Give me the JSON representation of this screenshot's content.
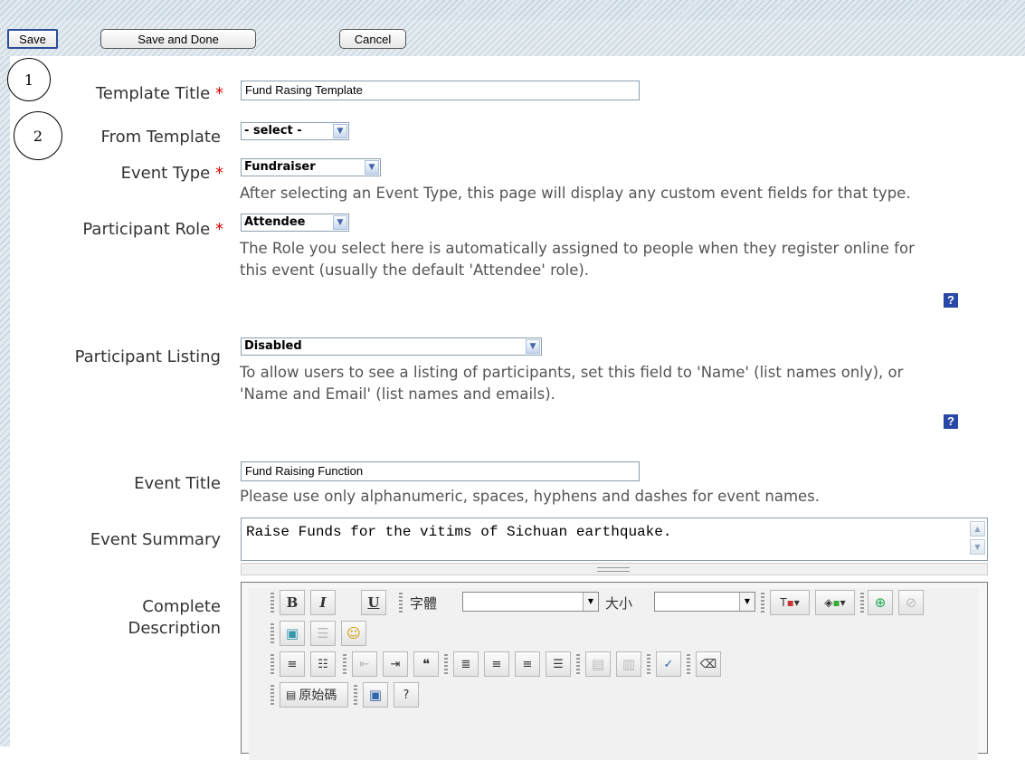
{
  "toolbar": {
    "save_label": "Save",
    "save_done_label": "Save and Done",
    "cancel_label": "Cancel"
  },
  "markers": [
    "1",
    "2"
  ],
  "form": {
    "template_title": {
      "label": "Template Title",
      "required": "*",
      "value": "Fund Rasing Template"
    },
    "from_template": {
      "label": "From Template",
      "value": "- select -"
    },
    "event_type": {
      "label": "Event Type",
      "required": "*",
      "value": "Fundraiser",
      "hint": "After selecting an Event Type, this page will display any custom event fields for that type."
    },
    "participant_role": {
      "label": "Participant Role",
      "required": "*",
      "value": "Attendee",
      "hint_line1": "The Role you select here is automatically assigned to people when they register online for",
      "hint_line2": "this event (usually the default 'Attendee' role).",
      "help": "?"
    },
    "participant_listing": {
      "label": "Participant Listing",
      "value": "Disabled",
      "hint_line1": "To allow users to see a listing of participants, set this field to 'Name' (list names only), or",
      "hint_line2": "'Name and Email' (list names and emails).",
      "help": "?"
    },
    "event_title": {
      "label": "Event Title",
      "value": "Fund Raising Function",
      "hint": "Please use only alphanumeric, spaces, hyphens and dashes for event names."
    },
    "event_summary": {
      "label": "Event Summary",
      "value": "Raise Funds for the vitims of Sichuan earthquake."
    },
    "complete_description": {
      "label_line1": "Complete",
      "label_line2": "Description"
    }
  },
  "editor": {
    "font_label": "字體",
    "size_label": "大小",
    "source_label": "原始碼",
    "icons": [
      "bold-icon",
      "italic-icon",
      "underline-icon",
      "text-color-icon",
      "background-color-icon",
      "link-icon",
      "unlink-icon",
      "image-icon",
      "horizontal-rule-icon",
      "smiley-icon",
      "numbered-list-icon",
      "bulleted-list-icon",
      "outdent-icon",
      "indent-icon",
      "blockquote-icon",
      "align-left-icon",
      "align-center-icon",
      "align-right-icon",
      "justify-icon",
      "paste-icon",
      "paste-word-icon",
      "spellcheck-icon",
      "eraser-icon",
      "source-icon",
      "maximize-icon",
      "about-icon"
    ]
  },
  "colors": {
    "accent": "#2848a8",
    "required": "#dd0000",
    "label": "#333333",
    "hint": "#555555"
  }
}
